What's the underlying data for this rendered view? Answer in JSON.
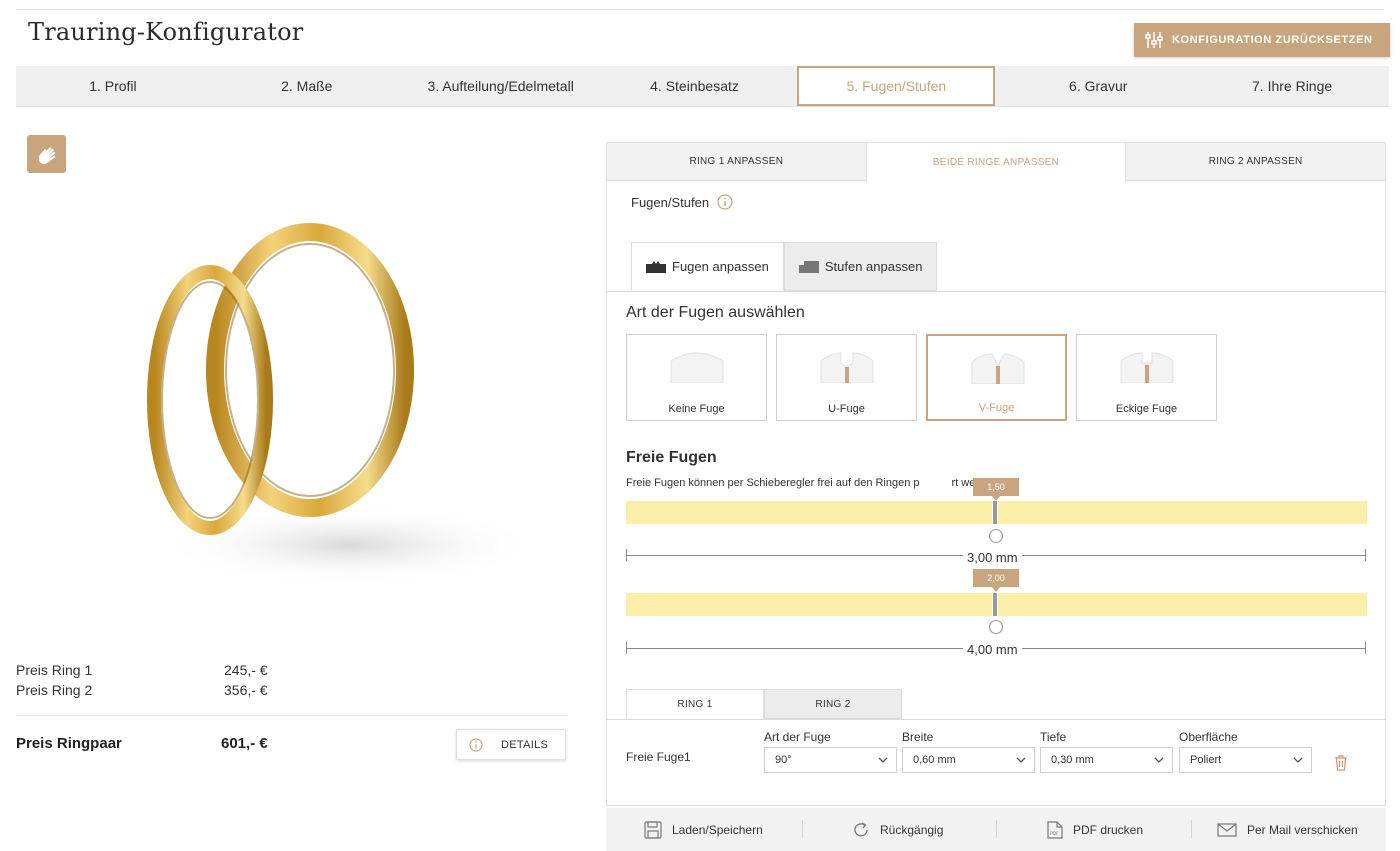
{
  "app": {
    "title": "Trauring-Konfigurator",
    "reset_label": "KONFIGURATION ZURÜCKSETZEN",
    "accent_color": "#c8a57e"
  },
  "steps": [
    {
      "label": "1. Profil",
      "active": false
    },
    {
      "label": "2. Maße",
      "active": false
    },
    {
      "label": "3. Aufteilung/Edelmetall",
      "active": false
    },
    {
      "label": "4. Steinbesatz",
      "active": false
    },
    {
      "label": "5. Fugen/Stufen",
      "active": true
    },
    {
      "label": "6. Gravur",
      "active": false
    },
    {
      "label": "7. Ihre Ringe",
      "active": false
    }
  ],
  "prices": {
    "ring1_label": "Preis Ring 1",
    "ring1_value": "245,- €",
    "ring2_label": "Preis Ring 2",
    "ring2_value": "356,- €",
    "total_label": "Preis Ringpaar",
    "total_value": "601,- €",
    "details_label": "DETAILS"
  },
  "panel": {
    "ring_tabs": [
      {
        "label": "RING 1 ANPASSEN",
        "active": false
      },
      {
        "label": "BEIDE RINGE ANPASSEN",
        "active": true
      },
      {
        "label": "RING 2 ANPASSEN",
        "active": false
      }
    ],
    "section_label": "Fugen/Stufen",
    "sub_tabs": {
      "fugen": "Fugen anpassen",
      "stufen": "Stufen anpassen"
    },
    "art_title": "Art der Fugen auswählen",
    "fuge_types": [
      {
        "label": "Keine Fuge",
        "selected": false
      },
      {
        "label": "U-Fuge",
        "selected": false
      },
      {
        "label": "V-Fuge",
        "selected": true
      },
      {
        "label": "Eckige Fuge",
        "selected": false
      }
    ],
    "free_title": "Freie Fugen",
    "free_desc_before": "Freie Fugen können per Schieberegler frei auf den Ringen p",
    "free_desc_after": "rt werden.",
    "slider1": {
      "tip": "1,50",
      "width_label": "3,00 mm"
    },
    "slider2": {
      "tip": "2,00",
      "width_label": "4,00 mm"
    },
    "ring_subtabs": [
      {
        "label": "RING 1",
        "active": true
      },
      {
        "label": "RING 2",
        "active": false
      }
    ],
    "row_label": "Freie Fuge1",
    "fields": {
      "art_label": "Art der Fuge",
      "art_value": "90°",
      "breite_label": "Breite",
      "breite_value": "0,60 mm",
      "tiefe_label": "Tiefe",
      "tiefe_value": "0,30 mm",
      "oberflaeche_label": "Oberfläche",
      "oberflaeche_value": "Poliert"
    }
  },
  "bottom_bar": {
    "save": "Laden/Speichern",
    "undo": "Rückgängig",
    "pdf": "PDF drucken",
    "mail": "Per Mail verschicken"
  }
}
